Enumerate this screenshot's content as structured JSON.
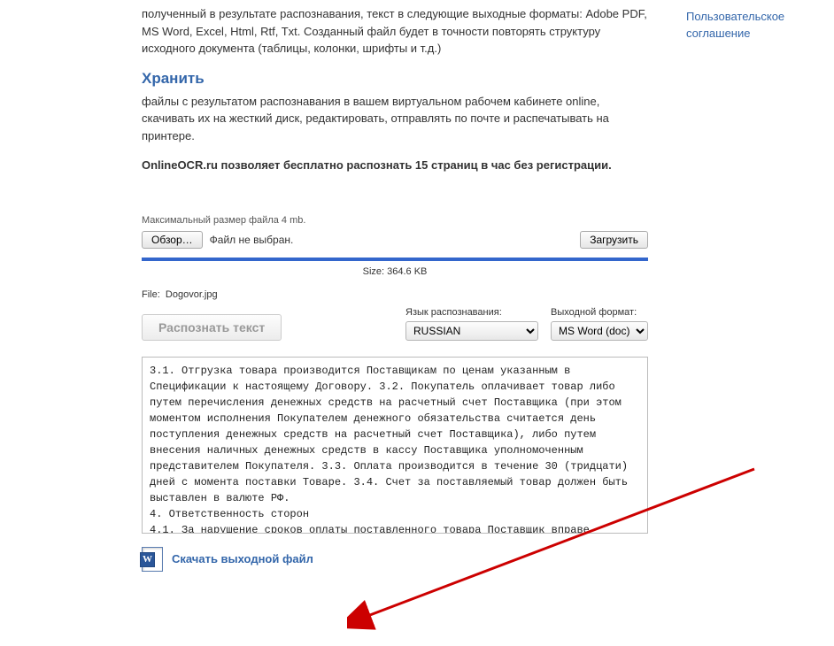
{
  "sidebar": {
    "agreement_link": "Пользовательское соглашение"
  },
  "content": {
    "para1": "полученный в результате распознавания, текст в следующие выходные форматы: Adobe PDF, MS Word, Excel, Html, Rtf, Txt. Созданный файл будет в точности повторять структуру исходного документа (таблицы, колонки, шрифты и т.д.)",
    "heading2": "Хранить",
    "para2": "файлы с результатом распознавания в вашем виртуальном рабочем кабинете online, скачивать их на жесткий диск, редактировать, отправлять по почте и распечатывать на принтере.",
    "promo": "OnlineOCR.ru позволяет бесплатно распознать 15 страниц в час без регистрации."
  },
  "upload": {
    "hint": "Максимальный размер файла 4 mb.",
    "browse_label": "Обзор…",
    "no_file_label": "Файл не выбран.",
    "upload_label": "Загрузить",
    "size_label": "Size: 364.6 KB",
    "file_prefix": "File:",
    "file_name": "Dogovor.jpg"
  },
  "recognize": {
    "button": "Распознать текст",
    "lang_label": "Язык распознавания:",
    "lang_value": "RUSSIAN",
    "format_label": "Выходной формат:",
    "format_value": "MS Word (doc)"
  },
  "result_text": "3.1. Отгрузка товара производится Поставщикам по ценам указанным в Спецификации к настоящему Договору. 3.2. Покупатель оплачивает товар либо путем перечисления денежных средств на расчетный счет Поставщика (при этом моментом исполнения Покупателем денежного обязательства считается день поступления денежных средств на расчетный счет Поставщика), либо путем внесения наличных денежных средств в кассу Поставщика уполномоченным представителем Покупателя. 3.3. Оплата производится в течение 30 (тридцати) дней с момента поставки Товаре. 3.4. Счет за поставляемый товар должен быть выставлен в валюте РФ.\n4. Ответственность сторон\n4.1. За нарушение сроков оплаты поставленного товара Поставщик вправе потребовать, а Покупатель обязан уплатить пени н размере",
  "download": {
    "label": "Cкачать выходной файл",
    "icon_letter": "W"
  }
}
